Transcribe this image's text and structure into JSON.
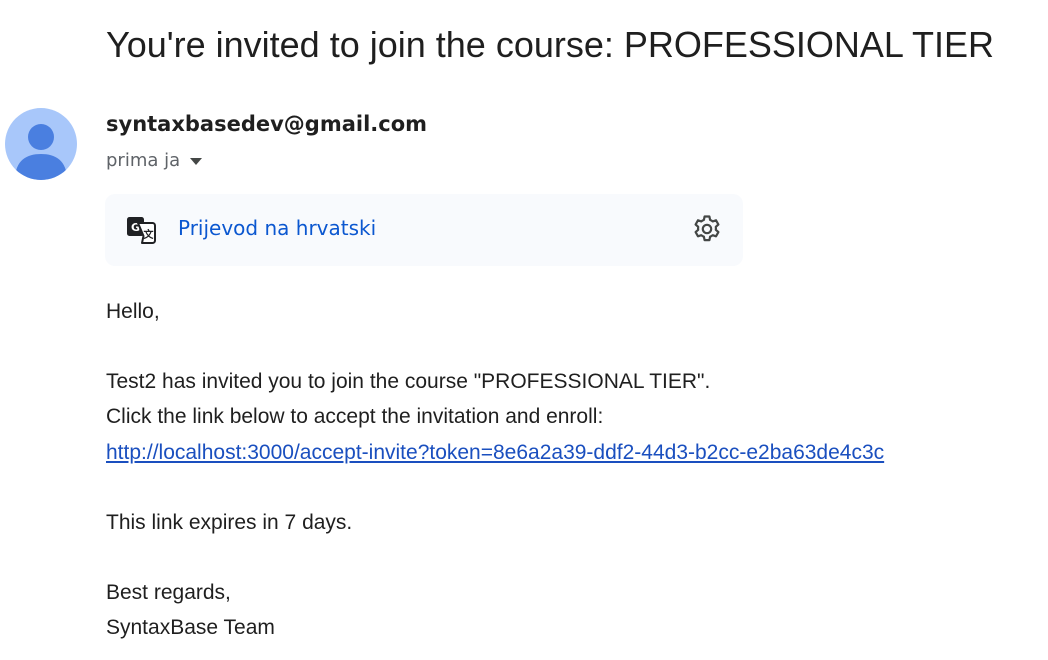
{
  "email": {
    "subject": "You're invited to join the course: PROFESSIONAL TIER",
    "sender": "syntaxbasedev@gmail.com",
    "recipient": "prima ja"
  },
  "translate_bar": {
    "label": "Prijevod na hrvatski"
  },
  "body": {
    "greeting": "Hello,",
    "invite_line": "Test2 has invited you to join the course \"PROFESSIONAL TIER\".",
    "instruction_line": "Click the link below to accept the invitation and enroll:",
    "link": "http://localhost:3000/accept-invite?token=8e6a2a39-ddf2-44d3-b2cc-e2ba63de4c3c",
    "expiry": "This link expires in 7 days.",
    "closing": "Best regards,",
    "signature": "SyntaxBase Team"
  },
  "icons": {
    "avatar": "person-icon",
    "recipient_toggle": "caret-down-icon",
    "translate": "google-translate-icon",
    "settings": "gear-icon"
  },
  "colors": {
    "avatar_bg": "#a8c7fa",
    "avatar_fg": "#4a7fe0",
    "link": "#1a4fbf",
    "translate_label": "#0b57d0",
    "translate_bar_bg": "#f8fafd"
  }
}
